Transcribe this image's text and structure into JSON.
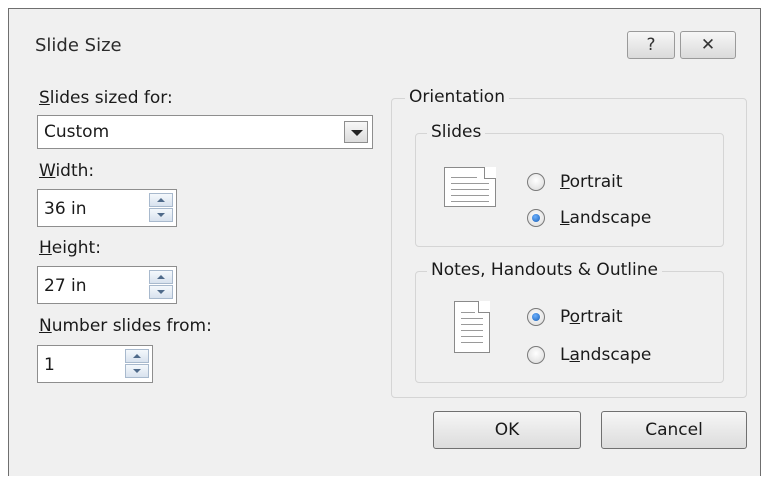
{
  "window": {
    "title": "Slide Size",
    "help_glyph": "?",
    "close_glyph": "✕"
  },
  "size": {
    "sized_for_label": "Slides sized for:",
    "sized_for_value": "Custom",
    "width_label": "Width:",
    "width_value": "36 in",
    "height_label": "Height:",
    "height_value": "27 in",
    "number_from_label": "Number slides from:",
    "number_from_value": "1"
  },
  "orientation": {
    "title": "Orientation",
    "slides": {
      "title": "Slides",
      "portrait_label": "Portrait",
      "landscape_label": "Landscape",
      "selected": "Landscape"
    },
    "notes": {
      "title": "Notes, Handouts & Outline",
      "portrait_label": "Portrait",
      "landscape_label": "Landscape",
      "selected": "Portrait"
    }
  },
  "buttons": {
    "ok": "OK",
    "cancel": "Cancel"
  }
}
